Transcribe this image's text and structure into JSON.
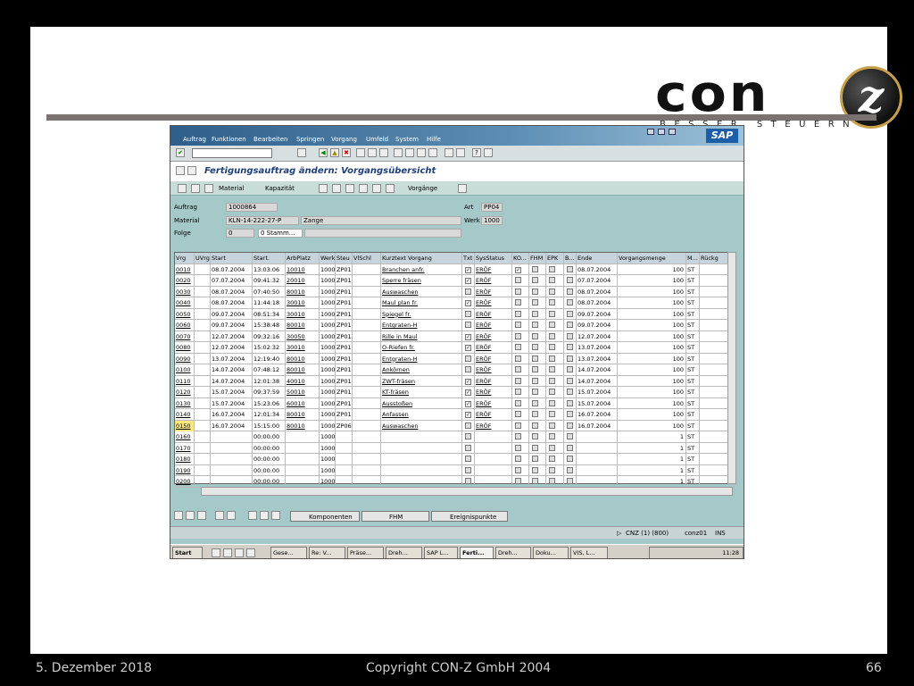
{
  "slide": {
    "footer_date": "5. Dezember 2018",
    "footer_copyright": "Copyright CON-Z GmbH 2004",
    "footer_page": "66"
  },
  "logo": {
    "word": "con",
    "mark": "z",
    "tagline": "BESSER STEUERN"
  },
  "sap": {
    "menu": [
      "Auftrag",
      "Funktionen",
      "Bearbeiten",
      "Springen",
      "Vorgang",
      "Umfeld",
      "System",
      "Hilfe"
    ],
    "title": "Fertigungsauftrag ändern: Vorgangsübersicht",
    "logo": "SAP",
    "app_toolbar": {
      "material": "Material",
      "kapazitaet": "Kapazität",
      "vorgaenge": "Vorgänge"
    },
    "header": {
      "auftrag_label": "Auftrag",
      "auftrag_value": "1000864",
      "art_label": "Art",
      "art_value": "PP04",
      "material_label": "Material",
      "material_value": "KLN-14-222-27-P",
      "material_text": "Zange",
      "werk_label": "Werk",
      "werk_value": "1000",
      "folge_label": "Folge",
      "folge_value": "0",
      "folge_text": "0 Stamm..."
    },
    "columns": [
      "Vrg",
      "UVrg",
      "Start",
      "Start.",
      "ArbPlatz",
      "Werk",
      "Steu",
      "VlSchl",
      "Kurztext Vorgang",
      "Txt",
      "SysStatus",
      "KO...",
      "FHM",
      "EPK",
      "B...",
      "Ende",
      "Vorgangsmenge",
      "M...",
      "Rückg"
    ],
    "rows": [
      {
        "vrg": "0010",
        "start": "08.07.2004",
        "time": "13:03:06",
        "arb": "10010",
        "werk": "1000",
        "steu": "ZP01",
        "text": "Branchen anfr.",
        "txt": true,
        "sys": "ERÖF",
        "ko": true,
        "ende": "08.07.2004",
        "menge": "100",
        "me": "ST"
      },
      {
        "vrg": "0020",
        "start": "07.07.2004",
        "time": "09:41:32",
        "arb": "20010",
        "werk": "1000",
        "steu": "ZP01",
        "text": "Sperre fräsen",
        "txt": true,
        "sys": "ERÖF",
        "ko": false,
        "ende": "07.07.2004",
        "menge": "100",
        "me": "ST"
      },
      {
        "vrg": "0030",
        "start": "08.07.2004",
        "time": "07:40:50",
        "arb": "80010",
        "werk": "1000",
        "steu": "ZP01",
        "text": "Auswaschen",
        "txt": false,
        "sys": "ERÖF",
        "ko": false,
        "ende": "08.07.2004",
        "menge": "100",
        "me": "ST"
      },
      {
        "vrg": "0040",
        "start": "08.07.2004",
        "time": "11:44:18",
        "arb": "30010",
        "werk": "1000",
        "steu": "ZP01",
        "text": "Maul plan fr.",
        "txt": true,
        "sys": "ERÖF",
        "ko": false,
        "ende": "08.07.2004",
        "menge": "100",
        "me": "ST"
      },
      {
        "vrg": "0050",
        "start": "09.07.2004",
        "time": "08:51:34",
        "arb": "30010",
        "werk": "1000",
        "steu": "ZP01",
        "text": "Spiegel fr.",
        "txt": false,
        "sys": "ERÖF",
        "ko": false,
        "ende": "09.07.2004",
        "menge": "100",
        "me": "ST"
      },
      {
        "vrg": "0060",
        "start": "09.07.2004",
        "time": "15:38:48",
        "arb": "80010",
        "werk": "1000",
        "steu": "ZP01",
        "text": "Entgraten-H",
        "txt": false,
        "sys": "ERÖF",
        "ko": false,
        "ende": "09.07.2004",
        "menge": "100",
        "me": "ST"
      },
      {
        "vrg": "0070",
        "start": "12.07.2004",
        "time": "09:32:16",
        "arb": "30050",
        "werk": "1000",
        "steu": "ZP01",
        "text": "Rille in Maul",
        "txt": true,
        "sys": "ERÖF",
        "ko": false,
        "ende": "12.07.2004",
        "menge": "100",
        "me": "ST"
      },
      {
        "vrg": "0080",
        "start": "12.07.2004",
        "time": "15:02:32",
        "arb": "30010",
        "werk": "1000",
        "steu": "ZP01",
        "text": "O-Riefen fr.",
        "txt": true,
        "sys": "ERÖF",
        "ko": false,
        "ende": "13.07.2004",
        "menge": "100",
        "me": "ST"
      },
      {
        "vrg": "0090",
        "start": "13.07.2004",
        "time": "12:19:40",
        "arb": "80010",
        "werk": "1000",
        "steu": "ZP01",
        "text": "Entgraten-H",
        "txt": false,
        "sys": "ERÖF",
        "ko": false,
        "ende": "13.07.2004",
        "menge": "100",
        "me": "ST"
      },
      {
        "vrg": "0100",
        "start": "14.07.2004",
        "time": "07:48:12",
        "arb": "80010",
        "werk": "1000",
        "steu": "ZP01",
        "text": "Ankörnen",
        "txt": false,
        "sys": "ERÖF",
        "ko": false,
        "ende": "14.07.2004",
        "menge": "100",
        "me": "ST"
      },
      {
        "vrg": "0110",
        "start": "14.07.2004",
        "time": "12:01:38",
        "arb": "40010",
        "werk": "1000",
        "steu": "ZP01",
        "text": "ZWT-fräsen",
        "txt": true,
        "sys": "ERÖF",
        "ko": false,
        "ende": "14.07.2004",
        "menge": "100",
        "me": "ST"
      },
      {
        "vrg": "0120",
        "start": "15.07.2004",
        "time": "09:37:59",
        "arb": "50010",
        "werk": "1000",
        "steu": "ZP01",
        "text": "KT-fräsen",
        "txt": true,
        "sys": "ERÖF",
        "ko": false,
        "ende": "15.07.2004",
        "menge": "100",
        "me": "ST"
      },
      {
        "vrg": "0130",
        "start": "15.07.2004",
        "time": "15:23:06",
        "arb": "60010",
        "werk": "1000",
        "steu": "ZP01",
        "text": "Ausstoßen",
        "txt": true,
        "sys": "ERÖF",
        "ko": false,
        "ende": "15.07.2004",
        "menge": "100",
        "me": "ST"
      },
      {
        "vrg": "0140",
        "start": "16.07.2004",
        "time": "12:01:34",
        "arb": "80010",
        "werk": "1000",
        "steu": "ZP01",
        "text": "Anfassen",
        "txt": true,
        "sys": "ERÖF",
        "ko": false,
        "ende": "16.07.2004",
        "menge": "100",
        "me": "ST"
      },
      {
        "vrg": "0150",
        "start": "16.07.2004",
        "time": "15:15:00",
        "arb": "80010",
        "werk": "1000",
        "steu": "ZP06",
        "text": "Auswaschen",
        "txt": false,
        "sys": "ERÖF",
        "ko": false,
        "ende": "16.07.2004",
        "menge": "100",
        "me": "ST"
      },
      {
        "vrg": "0160",
        "start": "",
        "time": "00:00:00",
        "arb": "",
        "werk": "1000",
        "steu": "",
        "text": "",
        "txt": false,
        "sys": "",
        "ko": false,
        "ende": "",
        "menge": "1",
        "me": "ST"
      },
      {
        "vrg": "0170",
        "start": "",
        "time": "00:00:00",
        "arb": "",
        "werk": "1000",
        "steu": "",
        "text": "",
        "txt": false,
        "sys": "",
        "ko": false,
        "ende": "",
        "menge": "1",
        "me": "ST"
      },
      {
        "vrg": "0180",
        "start": "",
        "time": "00:00:00",
        "arb": "",
        "werk": "1000",
        "steu": "",
        "text": "",
        "txt": false,
        "sys": "",
        "ko": false,
        "ende": "",
        "menge": "1",
        "me": "ST"
      },
      {
        "vrg": "0190",
        "start": "",
        "time": "00:00:00",
        "arb": "",
        "werk": "1000",
        "steu": "",
        "text": "",
        "txt": false,
        "sys": "",
        "ko": false,
        "ende": "",
        "menge": "1",
        "me": "ST"
      },
      {
        "vrg": "0200",
        "start": "",
        "time": "00:00:00",
        "arb": "",
        "werk": "1000",
        "steu": "",
        "text": "",
        "txt": false,
        "sys": "",
        "ko": false,
        "ende": "",
        "menge": "1",
        "me": "ST"
      }
    ],
    "bottom_buttons": {
      "komponenten": "Komponenten",
      "fhm": "FHM",
      "ereignispunkte": "Ereignispunkte"
    },
    "status": {
      "system": "CNZ (1) (800)",
      "user": "conz01",
      "mode": "INS"
    },
    "taskbar": {
      "start": "Start",
      "items": [
        "Gese...",
        "Re: V...",
        "Präse...",
        "Dreh...",
        "SAP L...",
        "Ferti...",
        "Dreh...",
        "Doku...",
        "VIS, L..."
      ],
      "clock": "11:28"
    }
  }
}
